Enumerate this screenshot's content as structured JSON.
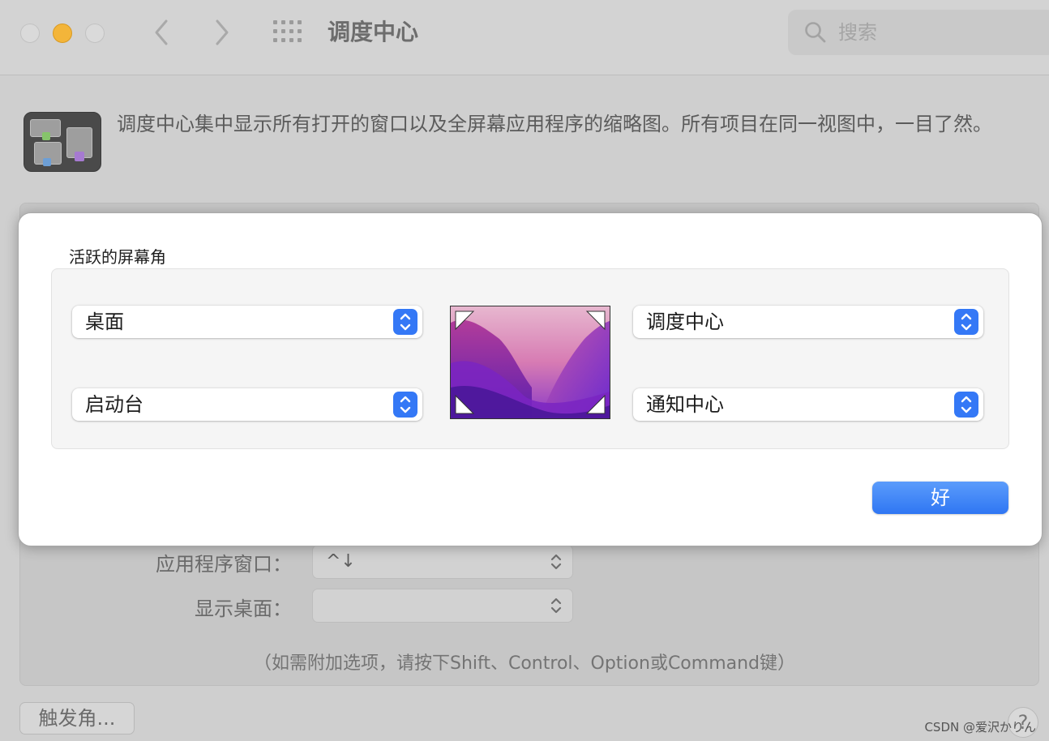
{
  "window": {
    "title": "调度中心",
    "search_placeholder": "搜索",
    "back_glyph": "‹",
    "forward_glyph": "›"
  },
  "header": {
    "description": "调度中心集中显示所有打开的窗口以及全屏幕应用程序的缩略图。所有项目在同一视图中，一目了然。"
  },
  "shortcuts": {
    "rows": [
      {
        "label": "应用程序窗口：",
        "value": "^↓"
      },
      {
        "label": "显示桌面：",
        "value": ""
      }
    ],
    "hint": "（如需附加选项，请按下Shift、Control、Option或Command键）",
    "hot_corners_button": "触发角...",
    "help_glyph": "?"
  },
  "sheet": {
    "title": "活跃的屏幕角",
    "corners": {
      "top_left": "桌面",
      "bottom_left": "启动台",
      "top_right": "调度中心",
      "bottom_right": "通知中心"
    },
    "ok_label": "好"
  },
  "watermark": "CSDN @爱沢かりん",
  "colors": {
    "accent": "#3478f6",
    "minimize": "#f3b53a"
  }
}
